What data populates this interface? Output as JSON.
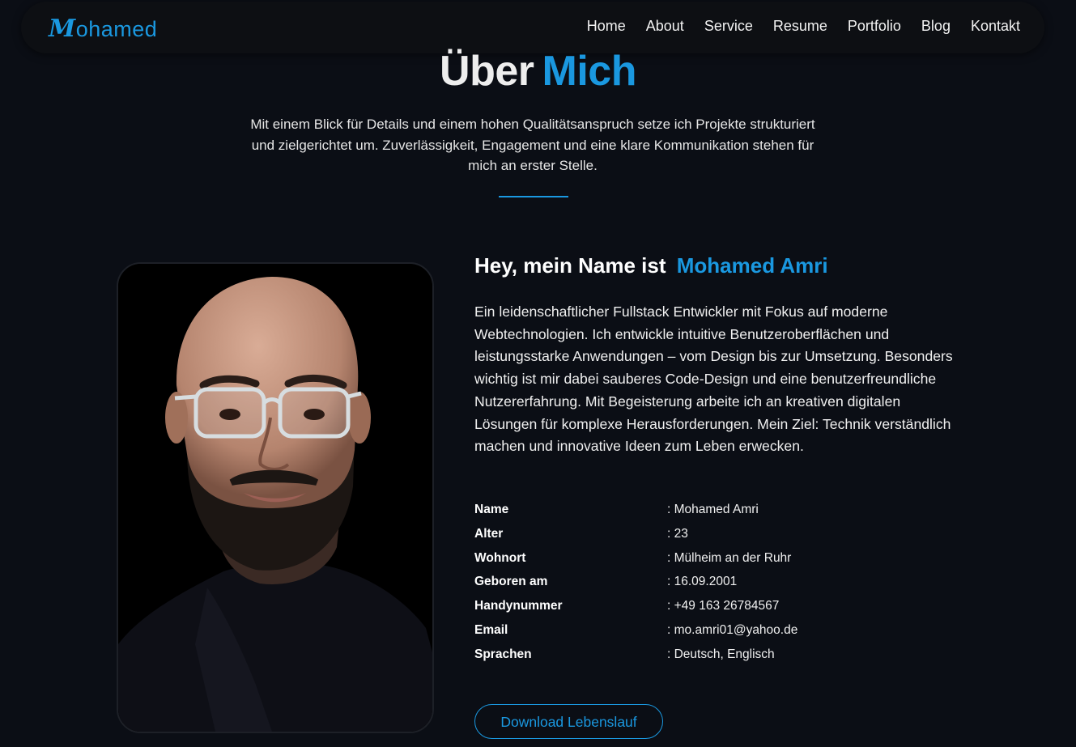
{
  "nav": {
    "logo_initial": "M",
    "logo_rest": "ohamed",
    "links": [
      "Home",
      "About",
      "Service",
      "Resume",
      "Portfolio",
      "Blog",
      "Kontakt"
    ]
  },
  "section": {
    "title_plain": "Über",
    "title_accent": "Mich",
    "intro": "Mit einem Blick für Details und einem hohen Qualitätsanspruch setze ich Projekte strukturiert und zielgerichtet um. Zuverlässigkeit, Engagement und eine klare Kommunikation stehen für mich an erster Stelle."
  },
  "about": {
    "greeting": "Hey, mein Name ist",
    "name": "Mohamed Amri",
    "bio": "Ein leidenschaftlicher Fullstack Entwickler mit Fokus auf moderne Webtechnologien. Ich entwickle intuitive Benutzeroberflächen und leistungsstarke Anwendungen – vom Design bis zur Umsetzung. Besonders wichtig ist mir dabei sauberes Code-Design und eine benutzerfreundliche Nutzererfahrung. Mit Begeisterung arbeite ich an kreativen digitalen Lösungen für komplexe Herausforderungen. Mein Ziel: Technik verständlich machen und innovative Ideen zum Leben erwecken.",
    "info": [
      {
        "label": "Name",
        "value": ": Mohamed Amri"
      },
      {
        "label": "Alter",
        "value": ": 23"
      },
      {
        "label": "Wohnort",
        "value": ": Mülheim an der Ruhr"
      },
      {
        "label": "Geboren am",
        "value": ": 16.09.2001"
      },
      {
        "label": "Handynummer",
        "value": ": +49 163 26784567"
      },
      {
        "label": "Email",
        "value": ": mo.amri01@yahoo.de"
      },
      {
        "label": "Sprachen",
        "value": ": Deutsch, Englisch"
      }
    ],
    "download_label": "Download Lebenslauf"
  },
  "colors": {
    "background": "#0b0e15",
    "accent": "#1a98e0",
    "nav_background": "#0d0f13"
  }
}
